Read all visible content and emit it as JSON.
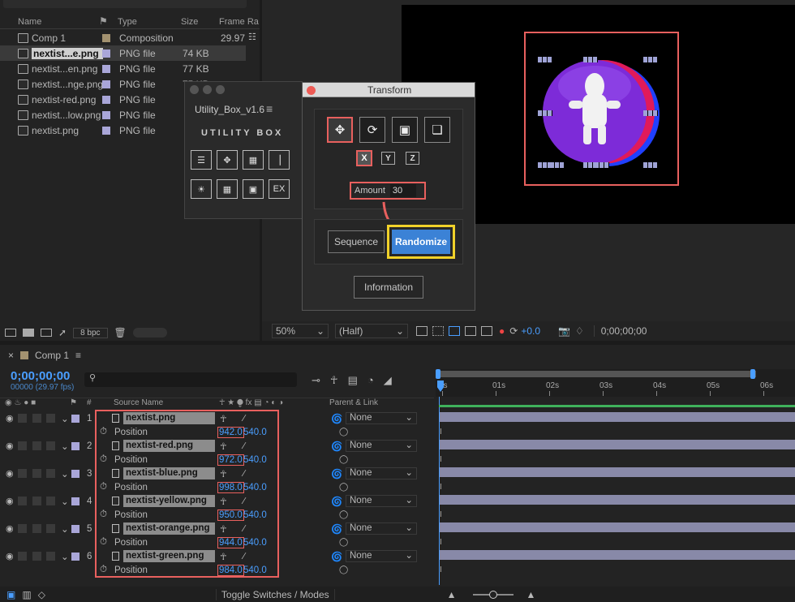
{
  "project": {
    "headers": [
      "Name",
      "Type",
      "Size",
      "Frame Ra"
    ],
    "items": [
      {
        "name": "Comp 1",
        "type": "Composition",
        "size": "",
        "frame": "29.97",
        "kind": "comp"
      },
      {
        "name": "nextist...e.png",
        "type": "PNG file",
        "size": "74 KB",
        "frame": "",
        "kind": "png",
        "selected": true
      },
      {
        "name": "nextist...en.png",
        "type": "PNG file",
        "size": "77 KB",
        "frame": "",
        "kind": "png"
      },
      {
        "name": "nextist...nge.png",
        "type": "PNG file",
        "size": "75 KB",
        "frame": "",
        "kind": "png"
      },
      {
        "name": "nextist-red.png",
        "type": "PNG file",
        "size": "",
        "frame": "",
        "kind": "png"
      },
      {
        "name": "nextist...low.png",
        "type": "PNG file",
        "size": "",
        "frame": "",
        "kind": "png"
      },
      {
        "name": "nextist.png",
        "type": "PNG file",
        "size": "",
        "frame": "",
        "kind": "png"
      }
    ],
    "bpc": "8 bpc"
  },
  "utility": {
    "title": "Utility_Box_v1.6",
    "logo": "UTILITY BOX",
    "ex": "EX"
  },
  "transform": {
    "title": "Transform",
    "x": "X",
    "y": "Y",
    "z": "Z",
    "amount_label": "Amount",
    "amount_value": "30",
    "sequence": "Sequence",
    "randomize": "Randomize",
    "information": "Information"
  },
  "viewer": {
    "zoom": "50%",
    "res": "(Half)",
    "exposure": "+0.0",
    "timecode": "0;00;00;00"
  },
  "timeline": {
    "tab": "Comp 1",
    "time": "0;00;00;00",
    "fps": "00000 (29.97 fps)",
    "source_name": "Source Name",
    "parent_link": "Parent & Link",
    "position": "Position",
    "none": "None",
    "toggle": "Toggle Switches / Modes",
    "ruler": [
      "0s",
      "01s",
      "02s",
      "03s",
      "04s",
      "05s",
      "06s"
    ],
    "layers": [
      {
        "num": "1",
        "name": "nextist.png",
        "x": "942.0",
        "y": "540.0"
      },
      {
        "num": "2",
        "name": "nextist-red.png",
        "x": "972.0",
        "y": "540.0"
      },
      {
        "num": "3",
        "name": "nextist-blue.png",
        "x": "998.0",
        "y": "540.0"
      },
      {
        "num": "4",
        "name": "nextist-yellow.png",
        "x": "950.0",
        "y": "540.0"
      },
      {
        "num": "5",
        "name": "nextist-orange.png",
        "x": "944.0",
        "y": "540.0"
      },
      {
        "num": "6",
        "name": "nextist-green.png",
        "x": "984.0",
        "y": "540.0"
      }
    ]
  },
  "colors": {
    "accent": "#4a9eff",
    "highlight": "#e8605e",
    "yellow": "#f0d12a",
    "randomize": "#3b82d6",
    "purple": "#7d2bd8"
  }
}
